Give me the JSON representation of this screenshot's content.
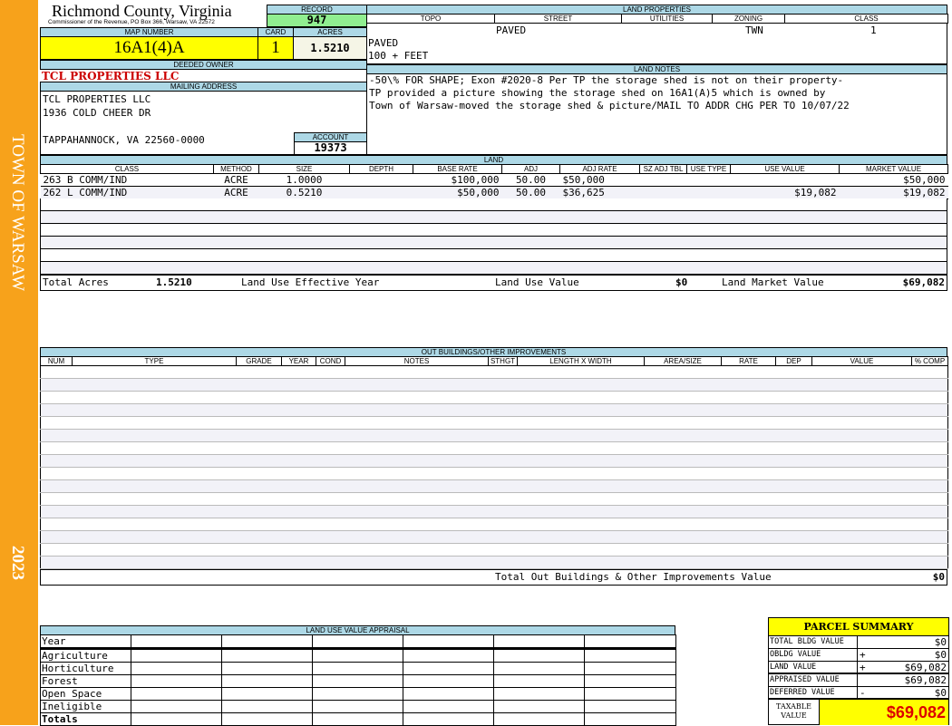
{
  "sidebar": {
    "town": "TOWN OF WARSAW",
    "year": "2023"
  },
  "header": {
    "county": "Richmond County, Virginia",
    "subtitle": "Commissioner of the Revenue, PO Box 366, Warsaw, VA 22572"
  },
  "record": {
    "label": "RECORD",
    "value": "947"
  },
  "map": {
    "label": "MAP NUMBER",
    "value": "16A1(4)A"
  },
  "card": {
    "label": "CARD",
    "value": "1"
  },
  "acres": {
    "label": "ACRES",
    "value": "1.5210"
  },
  "owner": {
    "label": "DEEDED OWNER",
    "value": "TCL PROPERTIES LLC"
  },
  "mailing": {
    "label": "MAILING ADDRESS",
    "line1": "TCL PROPERTIES LLC",
    "line2": "1936 COLD CHEER DR",
    "line3": "TAPPAHANNOCK, VA 22560-0000"
  },
  "account": {
    "label": "ACCOUNT",
    "value": "19373"
  },
  "land_properties": {
    "label": "LAND PROPERTIES",
    "headers": [
      "TOPO",
      "STREET",
      "UTILITIES",
      "ZONING",
      "CLASS"
    ],
    "street": "PAVED",
    "zoning": "TWN",
    "class": "1",
    "line1": "PAVED",
    "line2": "100 + FEET"
  },
  "land_notes": {
    "label": "LAND NOTES",
    "lines": [
      "-50\\% FOR SHAPE; Exon #2020-8 Per TP the storage shed is not on their property-",
      "TP provided a picture showing the storage shed on 16A1(A)5 which is owned by",
      "Town of Warsaw-moved the storage shed & picture/MAIL TO ADDR CHG PER TO 10/07/22"
    ]
  },
  "land": {
    "label": "LAND",
    "headers": [
      "CLASS",
      "METHOD",
      "SIZE",
      "DEPTH",
      "BASE RATE",
      "ADJ",
      "ADJ RATE",
      "SZ ADJ TBL",
      "USE TYPE",
      "USE VALUE",
      "MARKET VALUE"
    ],
    "rows": [
      [
        "263 B COMM/IND",
        "ACRE",
        "1.0000",
        "",
        "$100,000",
        "50.00",
        "$50,000",
        "",
        "",
        "",
        "$50,000"
      ],
      [
        "262 L COMM/IND",
        "ACRE",
        "0.5210",
        "",
        "$50,000",
        "50.00",
        "$36,625",
        "",
        "",
        "$19,082",
        "$19,082"
      ]
    ],
    "total_acres_label": "Total Acres",
    "total_acres": "1.5210",
    "effective_year_label": "Land Use Effective Year",
    "use_value_label": "Land Use Value",
    "use_value": "$0",
    "market_value_label": "Land Market Value",
    "market_value": "$69,082"
  },
  "outbuildings": {
    "label": "OUT BUILDINGS/OTHER IMPROVEMENTS",
    "headers": [
      "NUM",
      "TYPE",
      "GRADE",
      "YEAR",
      "COND",
      "NOTES",
      "STHGT",
      "LENGTH X WIDTH",
      "AREA/SIZE",
      "RATE",
      "DEP",
      "VALUE",
      "% COMP"
    ],
    "total_label": "Total Out Buildings & Other Improvements Value",
    "total": "$0"
  },
  "land_use": {
    "label": "LAND USE VALUE APPRAISAL",
    "year_label": "Year",
    "rows": [
      "Agriculture",
      "Horticulture",
      "Forest",
      "Open Space",
      "Ineligible"
    ],
    "totals_label": "Totals"
  },
  "summary": {
    "title": "PARCEL SUMMARY",
    "rows": [
      {
        "label": "TOTAL BLDG VALUE",
        "op": "",
        "value": "$0"
      },
      {
        "label": "OBLDG VALUE",
        "op": "+",
        "value": "$0"
      },
      {
        "label": "LAND VALUE",
        "op": "+",
        "value": "$69,082"
      },
      {
        "label": "APPRAISED VALUE",
        "op": "",
        "value": "$69,082"
      },
      {
        "label": "DEFERRED VALUE",
        "op": "-",
        "value": "$0"
      }
    ],
    "taxable_label": "TAXABLE VALUE",
    "taxable": "$69,082"
  },
  "colors": {
    "sidebar": "#f7a21b",
    "header": "#add8e6",
    "highlight": "#ffff00",
    "record": "#90ee90",
    "owner": "#cc0000"
  }
}
